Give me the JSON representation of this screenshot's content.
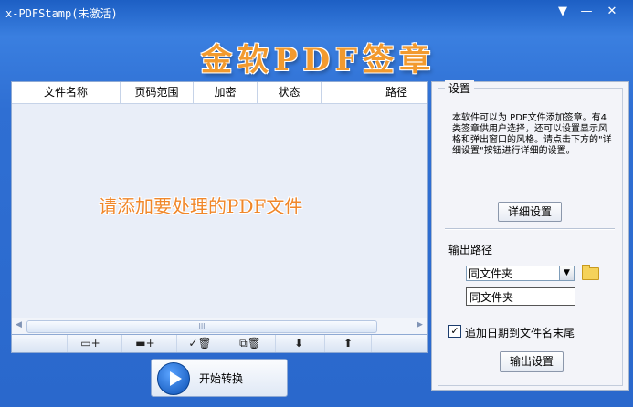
{
  "window": {
    "title": "x-PDFStamp(未激活)",
    "dropdown_glyph": "▼",
    "minimize_glyph": "—",
    "close_glyph": "✕"
  },
  "logo": {
    "text": "金软PDF签章"
  },
  "file_table": {
    "columns": [
      "文件名称",
      "页码范围",
      "加密",
      "状态",
      "路径"
    ],
    "empty_hint": "请添加要处理的PDF文件",
    "scroll_left": "◀",
    "scroll_right": "▶",
    "scroll_grip": "III"
  },
  "toolbar": {
    "tools": [
      {
        "name": "add-file",
        "glyph": "▭+"
      },
      {
        "name": "add-folder",
        "glyph": "▬+"
      },
      {
        "name": "remove-checked",
        "glyph": "✓🗑"
      },
      {
        "name": "remove-all",
        "glyph": "⧉🗑"
      },
      {
        "name": "move-down",
        "glyph": "⬇"
      },
      {
        "name": "move-up",
        "glyph": "⬆"
      }
    ]
  },
  "start_button": {
    "label": "开始转换"
  },
  "settings": {
    "legend": "设置",
    "description": "本软件可以为 PDF文件添加签章。有4类签章供用户选择，还可以设置显示风格和弹出窗口的风格。请点击下方的\"详细设置\"按钮进行详细的设置。",
    "detail_button": "详细设置",
    "output_path_label": "输出路径",
    "output_path_selected": "同文件夹",
    "output_path_value": "同文件夹",
    "append_date_label": "追加日期到文件名末尾",
    "append_date_checked": "✓",
    "output_settings_button": "输出设置"
  },
  "colors": {
    "window_blue": "#2f6fd3",
    "logo_orange": "#f29a2e",
    "hint_orange": "#f0872a",
    "panel_bg": "#f3f4f9"
  }
}
